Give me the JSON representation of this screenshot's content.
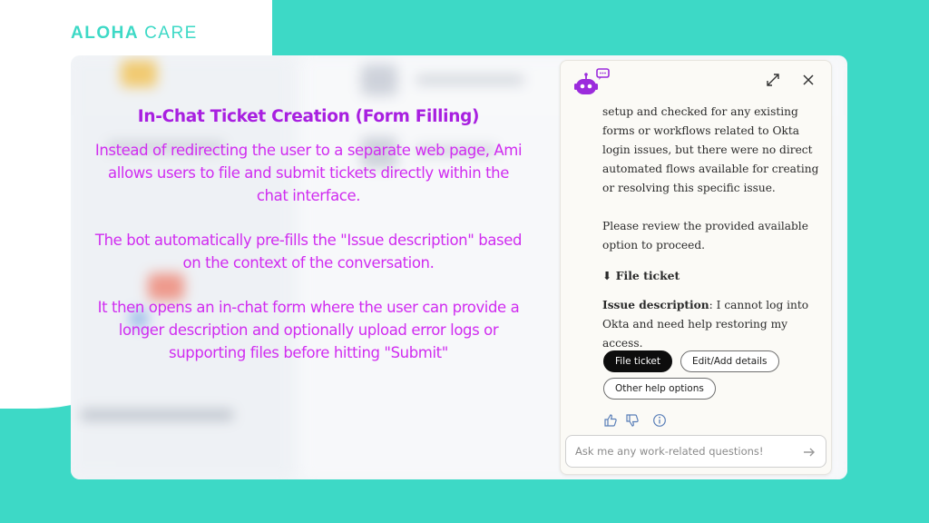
{
  "brand": {
    "part1": "ALOHA",
    "part2": "CARE",
    "color": "#3dd9c6"
  },
  "info": {
    "title": "In-Chat Ticket Creation (Form Filling)",
    "paragraphs": [
      "Instead of redirecting the user to a separate web page, Ami allows users to file and submit tickets directly within the chat interface.",
      "The bot automatically pre-fills the \"Issue description\" based on the context of the conversation.",
      "It then opens an in-chat form where the user can provide a longer description and optionally upload error logs or supporting files before hitting \"Submit\""
    ],
    "text_color": "#d02cf0",
    "title_color": "#a81fe0"
  },
  "chat": {
    "header": {
      "bot_icon": "robot-chat-icon",
      "expand_icon": "expand-icon",
      "close_icon": "close-icon",
      "accent": "#9b2bdc"
    },
    "message": {
      "paragraph1": "setup and checked for any existing forms or workflows related to Okta login issues, but there were no direct automated flows available for creating or resolving this specific issue.",
      "paragraph2": "Please review the provided available option to proceed.",
      "section_title": "⬇ File ticket",
      "issue_label": "Issue description",
      "issue_text": ": I cannot log into Okta and need help restoring my access."
    },
    "actions": {
      "file_ticket": "File ticket",
      "edit_details": "Edit/Add details",
      "other_help": "Other help options"
    },
    "feedback_icons": [
      "thumbs-up-icon",
      "thumbs-down-icon",
      "info-icon"
    ],
    "input": {
      "placeholder": "Ask me any work-related questions!",
      "value": "",
      "send_icon": "send-arrow-icon"
    }
  }
}
